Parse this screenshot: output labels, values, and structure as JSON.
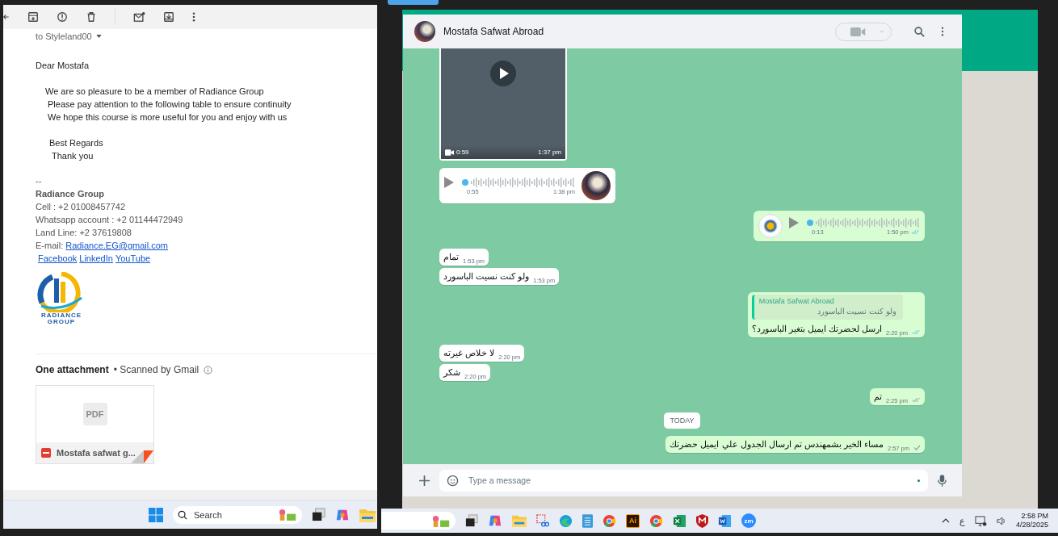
{
  "email": {
    "recipient": "to Styleland00",
    "greeting": "Dear Mostafa",
    "body": [
      "We are so pleasure to be a member of Radiance Group",
      "Please pay attention to the following table to ensure continuity",
      "We hope this course is more useful for you and enjoy with us"
    ],
    "closing": [
      "Best Regards",
      "Thank you"
    ],
    "separator": "--",
    "signature": {
      "name": "Radiance Group",
      "lines": [
        "Cell : +2 01008457742",
        "Whatsapp account : +2 01144472949",
        "Land Line: +2 37619808"
      ],
      "email_label": "E-mail:",
      "email": "Radiance.EG@gmail.com",
      "links": [
        "Facebook",
        "LinkedIn",
        "YouTube"
      ],
      "logo_text": [
        "RADIANCE",
        "GROUP"
      ]
    },
    "attachments": {
      "title": "One attachment",
      "scan_note": "• Scanned by Gmail",
      "files": [
        {
          "thumbnail": "PDF",
          "name": "Mostafa safwat g..."
        }
      ]
    }
  },
  "taskbar_left": {
    "search": "Search"
  },
  "chat": {
    "contact": "Mostafa Safwat Abroad",
    "messages": [
      {
        "kind": "video",
        "outgoing": false,
        "duration": "0:59",
        "time": "1:37 pm"
      },
      {
        "kind": "voice",
        "outgoing": false,
        "duration": "0:55",
        "time": "1:38 pm"
      },
      {
        "kind": "voice",
        "outgoing": true,
        "duration": "0:13",
        "time": "1:50 pm",
        "delivered": true,
        "read": true
      },
      {
        "kind": "text",
        "outgoing": false,
        "text": "تمام",
        "time": "1:53 pm"
      },
      {
        "kind": "text",
        "outgoing": false,
        "text": "ولو كنت نسيت الباسورد",
        "time": "1:53 pm"
      },
      {
        "kind": "reply",
        "outgoing": true,
        "quote_author": "Mostafa Safwat Abroad",
        "quote_text": "ولو كنت نسيت الباسورد",
        "text": "ارسل لحضرتك ايميل بتغير الباسورد؟",
        "time": "2:20 pm",
        "delivered": true,
        "read": true
      },
      {
        "kind": "text",
        "outgoing": false,
        "text": "لا خلاص غيرته",
        "time": "2:20 pm"
      },
      {
        "kind": "text",
        "outgoing": false,
        "text": "شكر",
        "time": "2:20 pm"
      },
      {
        "kind": "text",
        "outgoing": true,
        "text": "تم",
        "time": "2:25 pm",
        "delivered": true,
        "read": false
      },
      {
        "kind": "date",
        "text": "TODAY"
      },
      {
        "kind": "text",
        "outgoing": true,
        "text": "مساء الخير بشمهندس تم ارسال الجدول علي ايميل حضرتك",
        "time": "2:57 pm",
        "delivered": false,
        "read": false
      }
    ],
    "composer": {
      "placeholder": "Type a message"
    }
  },
  "taskbar_right": {
    "apps": [
      {
        "kind": "taskview"
      },
      {
        "kind": "copilot"
      },
      {
        "kind": "folder"
      },
      {
        "kind": "snip"
      },
      {
        "kind": "edge"
      },
      {
        "kind": "notepad"
      },
      {
        "kind": "chrome"
      },
      {
        "kind": "illustrator",
        "label": "Ai"
      },
      {
        "kind": "chrome"
      },
      {
        "kind": "excel"
      },
      {
        "kind": "mcafee"
      },
      {
        "kind": "word"
      },
      {
        "kind": "zoom",
        "label": "zm"
      }
    ],
    "language": "ع",
    "time": "2:58 PM",
    "date": "4/28/2025"
  }
}
